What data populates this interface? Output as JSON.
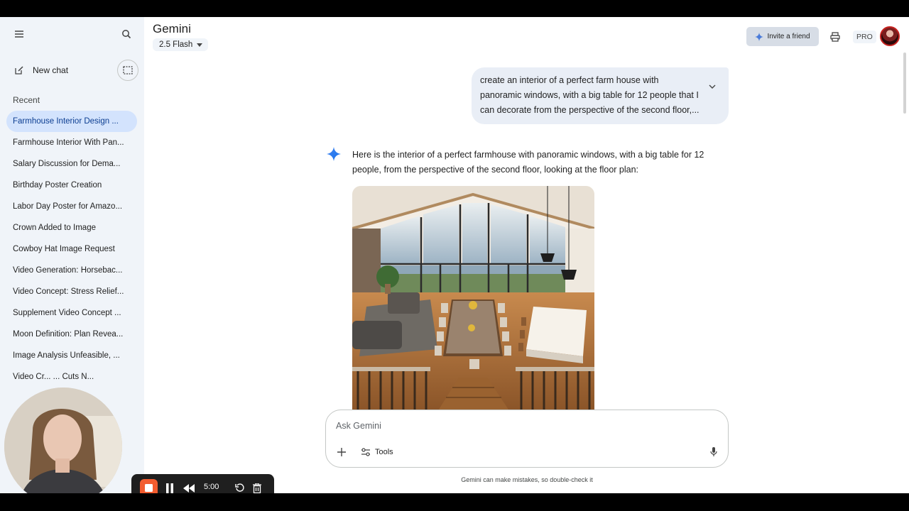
{
  "sidebar": {
    "new_chat": "New chat",
    "recent_heading": "Recent",
    "chats": [
      {
        "label": "Farmhouse Interior Design ..."
      },
      {
        "label": "Farmhouse Interior With Pan..."
      },
      {
        "label": "Salary Discussion for Dema..."
      },
      {
        "label": "Birthday Poster Creation"
      },
      {
        "label": "Labor Day Poster for Amazo..."
      },
      {
        "label": "Crown Added to Image"
      },
      {
        "label": "Cowboy Hat Image Request"
      },
      {
        "label": "Video Generation: Horsebac..."
      },
      {
        "label": "Video Concept: Stress Relief..."
      },
      {
        "label": "Supplement Video Concept ..."
      },
      {
        "label": "Moon Definition: Plan Revea..."
      },
      {
        "label": "Image Analysis Unfeasible, ..."
      },
      {
        "label": "Video Cr...  ... Cuts N..."
      }
    ]
  },
  "header": {
    "title": "Gemini",
    "model": "2.5 Flash",
    "invite_label": "Invite a friend",
    "pro_label": "PRO"
  },
  "conversation": {
    "user_prompt": "create an interior of a perfect farm house with panoramic windows, with a big table for 12 people that I can decorate from the perspective of the second floor,...",
    "reply": "Here is the interior of a perfect farmhouse with panoramic windows, with a big table for 12 people, from the perspective of the second floor, looking at the floor plan:"
  },
  "composer": {
    "placeholder": "Ask Gemini",
    "tools_label": "Tools"
  },
  "disclaimer": "Gemini can make mistakes, so double-check it",
  "recorder": {
    "time": "5:00"
  },
  "colors": {
    "sidebar_bg": "#f0f4f9",
    "active_chat_bg": "#d3e3fd",
    "accent_blue": "#1a73e8",
    "record_orange": "#f25c2f"
  }
}
